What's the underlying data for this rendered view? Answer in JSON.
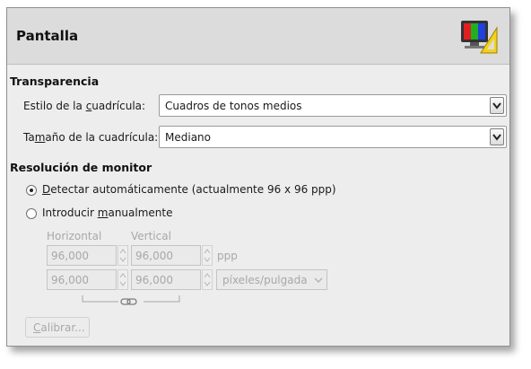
{
  "header": {
    "title": "Pantalla",
    "icon": "display-color-icon"
  },
  "transparency": {
    "section_title": "Transparencia",
    "grid_style_label_pre": "Estilo de la ",
    "grid_style_label_mn": "c",
    "grid_style_label_post": "uadrícula:",
    "grid_style_value": "Cuadros de tonos medios",
    "grid_size_label_pre": "Ta",
    "grid_size_label_mn": "m",
    "grid_size_label_post": "año de la cuadrícula:",
    "grid_size_value": "Mediano"
  },
  "resolution": {
    "section_title": "Resolución de monitor",
    "auto_mn": "D",
    "auto_rest": "etectar automáticamente (actualmente 96 x 96 ppp)",
    "manual_pre": "Introducir ",
    "manual_mn": "m",
    "manual_post": "anualmente",
    "selected": "auto",
    "horizontal_label": "Horizontal",
    "vertical_label": "Vertical",
    "row1_h": "96,000",
    "row1_v": "96,000",
    "row1_unit": "ppp",
    "row2_h": "96,000",
    "row2_v": "96,000",
    "row2_unit": "píxeles/pulgada",
    "calibrate_mn": "C",
    "calibrate_rest": "alibrar..."
  },
  "colors": {
    "window_bg": "#ededed",
    "header_bg": "#dcdcdc",
    "disabled_text": "#a8a8a8"
  }
}
